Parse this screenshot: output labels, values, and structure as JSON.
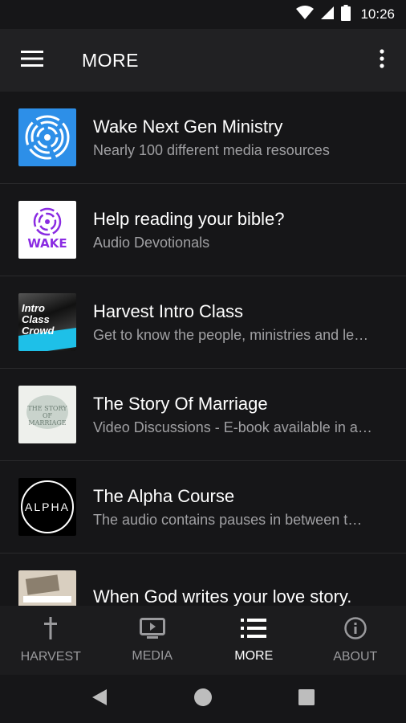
{
  "status_bar": {
    "time": "10:26"
  },
  "app_bar": {
    "title": "MORE"
  },
  "list": [
    {
      "title": "Wake Next Gen Ministry",
      "subtitle": "Nearly 100 different media resources",
      "thumb_icon": "wake-logo-blue"
    },
    {
      "title": "Help reading your bible?",
      "subtitle": "Audio Devotionals",
      "thumb_icon": "wake-logo-white",
      "thumb_text": "WAKE"
    },
    {
      "title": "Harvest Intro Class",
      "subtitle": "Get to know the people, ministries and le…",
      "thumb_icon": "intro-class-crowd-art",
      "thumb_text": "Intro Class Crowd"
    },
    {
      "title": "The Story Of Marriage",
      "subtitle": "Video Discussions - E-book available in a…",
      "thumb_icon": "story-of-marriage-cover",
      "thumb_text": "THE STORY OF MARRIAGE"
    },
    {
      "title": "The Alpha Course",
      "subtitle": "The audio contains  pauses in between t…",
      "thumb_icon": "alpha-logo",
      "thumb_text": "ALPHA"
    },
    {
      "title": "When God writes your love story.",
      "subtitle": "",
      "thumb_icon": "love-story-cover"
    }
  ],
  "bottom_nav": [
    {
      "label": "HARVEST",
      "icon": "cross-icon",
      "active": false
    },
    {
      "label": "MEDIA",
      "icon": "tv-icon",
      "active": false
    },
    {
      "label": "MORE",
      "icon": "list-icon",
      "active": true
    },
    {
      "label": "ABOUT",
      "icon": "info-icon",
      "active": false
    }
  ],
  "colors": {
    "background": "#161618",
    "app_bar": "#212123",
    "wake_blue": "#2d8fe8",
    "wake_purple": "#8a2be2"
  }
}
